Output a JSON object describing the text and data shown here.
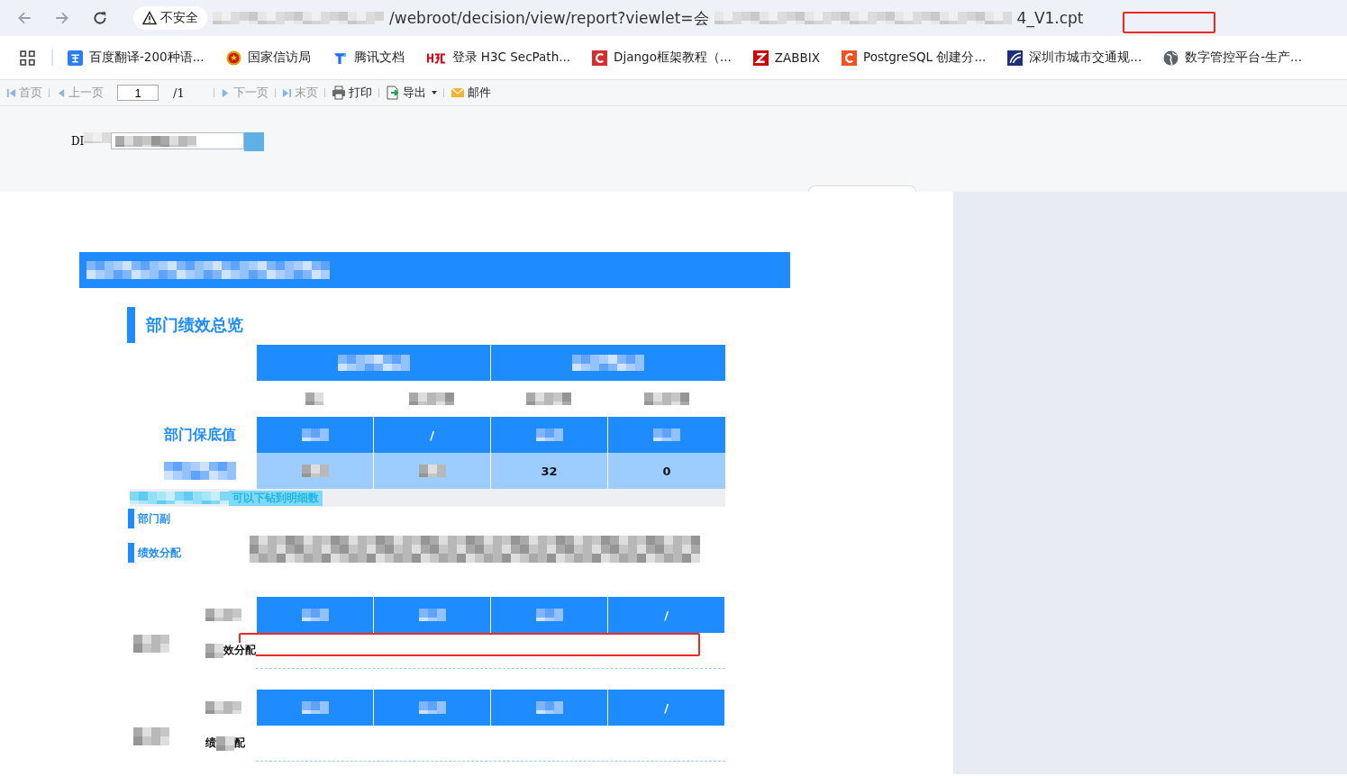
{
  "browser": {
    "security": "不安全",
    "url_start": "/webroot/decision/view/report?viewlet=会",
    "url_end": "4_V1.cpt"
  },
  "bookmarks": [
    {
      "label": "百度翻译-200种语...",
      "kind": "translate"
    },
    {
      "label": "国家信访局",
      "kind": "emblem"
    },
    {
      "label": "腾讯文档",
      "kind": "docs"
    },
    {
      "label": "登录 H3C SecPath...",
      "kind": "h3c"
    },
    {
      "label": "Django框架教程（...",
      "kind": "redc"
    },
    {
      "label": "ZABBIX",
      "kind": "redz"
    },
    {
      "label": "PostgreSQL 创建分...",
      "kind": "orangec"
    },
    {
      "label": "深圳市城市交通规...",
      "kind": "swoosh"
    },
    {
      "label": "数字管控平台-生产...",
      "kind": "globe"
    }
  ],
  "toolbar": {
    "items": [
      {
        "kind": "first",
        "label": "首页",
        "disabled": true
      },
      {
        "kind": "prev",
        "label": "上一页",
        "disabled": true
      },
      {
        "kind": "page",
        "value": "1",
        "total": "/1"
      },
      {
        "kind": "next",
        "label": "下一页",
        "disabled": true
      },
      {
        "kind": "last",
        "label": "末页",
        "disabled": true
      },
      {
        "kind": "print",
        "label": "打印",
        "disabled": false
      },
      {
        "kind": "export",
        "label": "导出",
        "disabled": false
      },
      {
        "kind": "mail",
        "label": "邮件",
        "disabled": false
      }
    ]
  },
  "parameters": {
    "label": "DI"
  },
  "report": {
    "section_title": "部门绩效总览",
    "rows": [
      {
        "kind": "header"
      },
      {
        "kind": "plain"
      },
      {
        "kind": "blue",
        "label": "部门保底值",
        "cells": [
          {
            "kind": "hidden"
          },
          {
            "kind": "text",
            "text": "/"
          },
          {
            "kind": "hidden"
          },
          {
            "kind": "hidden"
          }
        ]
      },
      {
        "kind": "light",
        "cells": [
          {
            "kind": "hidden"
          },
          {
            "kind": "hidden"
          },
          {
            "kind": "text",
            "text": "32"
          },
          {
            "kind": "text",
            "text": "0"
          }
        ]
      }
    ],
    "hint": "可以下钻到明细数",
    "side_labels": [
      "部门副",
      "绩效分配"
    ],
    "blocks": [
      {
        "label_end": "效分配",
        "cells": [
          {
            "kind": "hidden"
          },
          {
            "kind": "hidden"
          },
          {
            "kind": "hidden"
          },
          {
            "kind": "text",
            "text": "/"
          }
        ]
      },
      {
        "label_start": "绩",
        "label_end": "配",
        "cells": [
          {
            "kind": "hidden"
          },
          {
            "kind": "hidden"
          },
          {
            "kind": "hidden"
          },
          {
            "kind": "text",
            "text": "/"
          }
        ]
      }
    ]
  }
}
